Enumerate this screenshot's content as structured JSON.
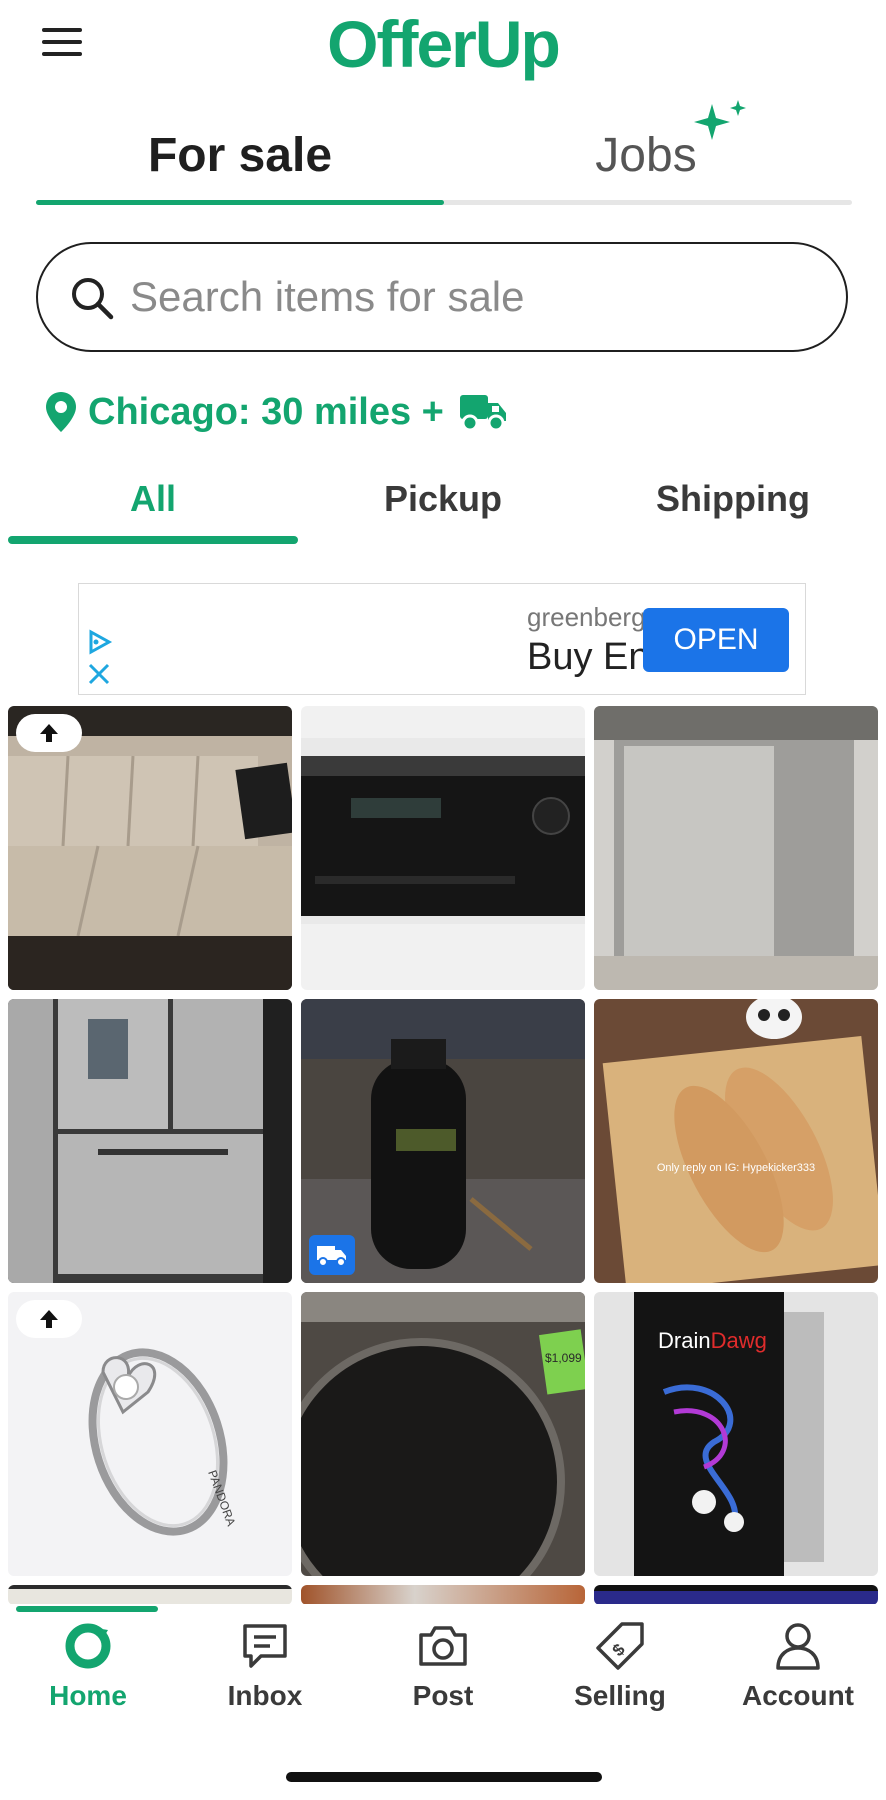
{
  "app": {
    "logo_text": "OfferUp",
    "brand_color": "#13a56f"
  },
  "top_tabs": [
    {
      "label": "For sale",
      "active": true
    },
    {
      "label": "Jobs",
      "active": false,
      "icon": "sparkle-icon"
    }
  ],
  "search": {
    "placeholder": "Search items for sale",
    "value": ""
  },
  "location": {
    "label": "Chicago: 30 miles +",
    "icon": "map-pin-icon",
    "shipping_icon": "truck-icon"
  },
  "filter_tabs": [
    {
      "label": "All",
      "active": true
    },
    {
      "label": "Pickup",
      "active": false
    },
    {
      "label": "Shipping",
      "active": false
    }
  ],
  "ad": {
    "sponsor": "greenberg",
    "headline": "Buy En",
    "button_label": "OPEN",
    "button_color": "#1b74e8"
  },
  "listings": [
    {
      "name": "sofa",
      "boosted": true,
      "shipping": false
    },
    {
      "name": "av-receiver",
      "boosted": false,
      "shipping": false
    },
    {
      "name": "dishwasher",
      "boosted": false,
      "shipping": false
    },
    {
      "name": "refrigerator",
      "boosted": false,
      "shipping": false
    },
    {
      "name": "concrete-sprayer",
      "boosted": false,
      "shipping": true
    },
    {
      "name": "loafers",
      "boosted": false,
      "shipping": false,
      "overlay_text": "Only reply on IG: Hypekicker333"
    },
    {
      "name": "ring",
      "boosted": true,
      "shipping": false,
      "engraving": "PANDORA"
    },
    {
      "name": "washer",
      "boosted": false,
      "shipping": false,
      "price_tag": "$1,099"
    },
    {
      "name": "drain-cleaner",
      "boosted": false,
      "shipping": false,
      "brand_text_a": "Drain",
      "brand_text_b": "Dawg"
    }
  ],
  "bottom_nav": [
    {
      "label": "Home",
      "icon": "home-icon",
      "active": true
    },
    {
      "label": "Inbox",
      "icon": "inbox-icon",
      "active": false
    },
    {
      "label": "Post",
      "icon": "camera-icon",
      "active": false
    },
    {
      "label": "Selling",
      "icon": "price-tag-icon",
      "active": false
    },
    {
      "label": "Account",
      "icon": "person-icon",
      "active": false
    }
  ]
}
